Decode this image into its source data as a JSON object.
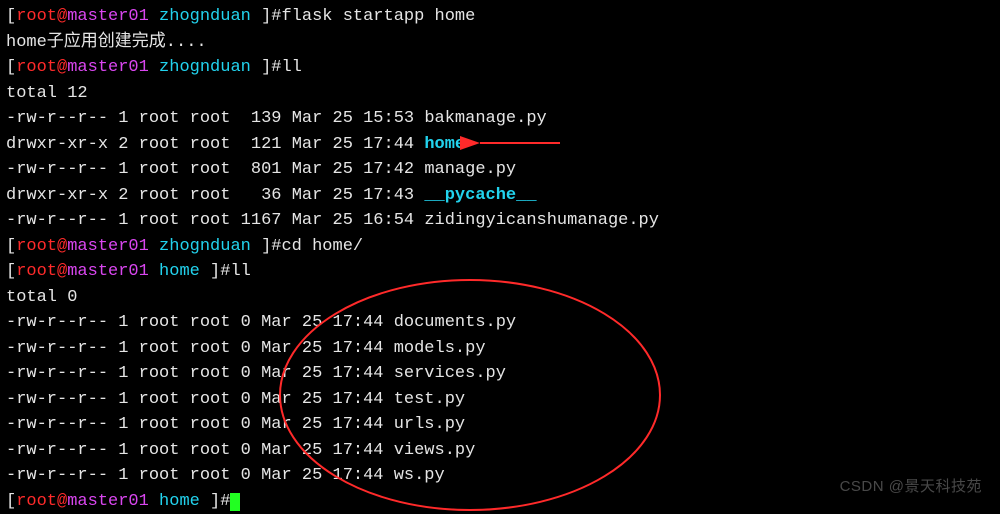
{
  "prompt": {
    "open": "[",
    "user": "root",
    "at": "@",
    "host": "master01",
    "dir1": "zhognduan",
    "dir2": "home",
    "close": " ]#"
  },
  "cmd": {
    "startapp": "flask startapp home",
    "ll": "ll",
    "cd": "cd home/"
  },
  "out": {
    "created": "home子应用创建完成....",
    "total12": "total 12",
    "total0": "total 0"
  },
  "ls1": [
    {
      "perm": "-rw-r--r--",
      "n": "1",
      "u": "root",
      "g": "root",
      "size": " 139",
      "date": "Mar 25 15:53",
      "name": "bakmanage.py",
      "link": false
    },
    {
      "perm": "drwxr-xr-x",
      "n": "2",
      "u": "root",
      "g": "root",
      "size": " 121",
      "date": "Mar 25 17:44",
      "name": "home",
      "link": true
    },
    {
      "perm": "-rw-r--r--",
      "n": "1",
      "u": "root",
      "g": "root",
      "size": " 801",
      "date": "Mar 25 17:42",
      "name": "manage.py",
      "link": false
    },
    {
      "perm": "drwxr-xr-x",
      "n": "2",
      "u": "root",
      "g": "root",
      "size": "  36",
      "date": "Mar 25 17:43",
      "name": "__pycache__",
      "link": true
    },
    {
      "perm": "-rw-r--r--",
      "n": "1",
      "u": "root",
      "g": "root",
      "size": "1167",
      "date": "Mar 25 16:54",
      "name": "zidingyicanshumanage.py",
      "link": false
    }
  ],
  "ls2": [
    {
      "perm": "-rw-r--r--",
      "n": "1",
      "u": "root",
      "g": "root",
      "size": "0",
      "date": "Mar 25 17:44",
      "name": "documents.py"
    },
    {
      "perm": "-rw-r--r--",
      "n": "1",
      "u": "root",
      "g": "root",
      "size": "0",
      "date": "Mar 25 17:44",
      "name": "models.py"
    },
    {
      "perm": "-rw-r--r--",
      "n": "1",
      "u": "root",
      "g": "root",
      "size": "0",
      "date": "Mar 25 17:44",
      "name": "services.py"
    },
    {
      "perm": "-rw-r--r--",
      "n": "1",
      "u": "root",
      "g": "root",
      "size": "0",
      "date": "Mar 25 17:44",
      "name": "test.py"
    },
    {
      "perm": "-rw-r--r--",
      "n": "1",
      "u": "root",
      "g": "root",
      "size": "0",
      "date": "Mar 25 17:44",
      "name": "urls.py"
    },
    {
      "perm": "-rw-r--r--",
      "n": "1",
      "u": "root",
      "g": "root",
      "size": "0",
      "date": "Mar 25 17:44",
      "name": "views.py"
    },
    {
      "perm": "-rw-r--r--",
      "n": "1",
      "u": "root",
      "g": "root",
      "size": "0",
      "date": "Mar 25 17:44",
      "name": "ws.py"
    }
  ],
  "watermark": "CSDN @景天科技苑"
}
